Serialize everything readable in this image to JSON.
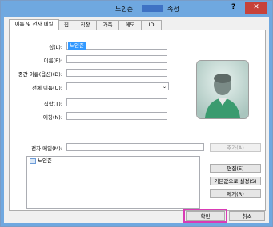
{
  "window": {
    "title_left": "노인준",
    "title_right": "속성",
    "help": "?",
    "close": "✕"
  },
  "tabs": [
    "이름 및 전자 메일",
    "집",
    "직장",
    "가족",
    "메모",
    "ID"
  ],
  "fields": {
    "last_name_label": "성(L):",
    "last_name_value": "노인준",
    "first_name_label": "이름(E):",
    "middle_name_label": "중간 이름(옵션)(D):",
    "display_name_label": "전체 이름(U):",
    "title_label": "직함(T):",
    "nickname_label": "애칭(N):"
  },
  "email": {
    "label": "전자 메일(M):",
    "add_button": "추가(A)",
    "edit_button": "편집(E)",
    "set_default_button": "기본값으로 설정(S)",
    "remove_button": "제거(R)",
    "entries": [
      "노인준"
    ]
  },
  "footer": {
    "ok_button": "확인",
    "cancel_button": "취소"
  },
  "colors": {
    "accent": "#6fa8e0",
    "selection": "#3399ff",
    "focus_outline": "#d93bb5"
  },
  "icons": {
    "contact_photo": "person-avatar-icon",
    "email_entry": "contact-card-icon"
  }
}
